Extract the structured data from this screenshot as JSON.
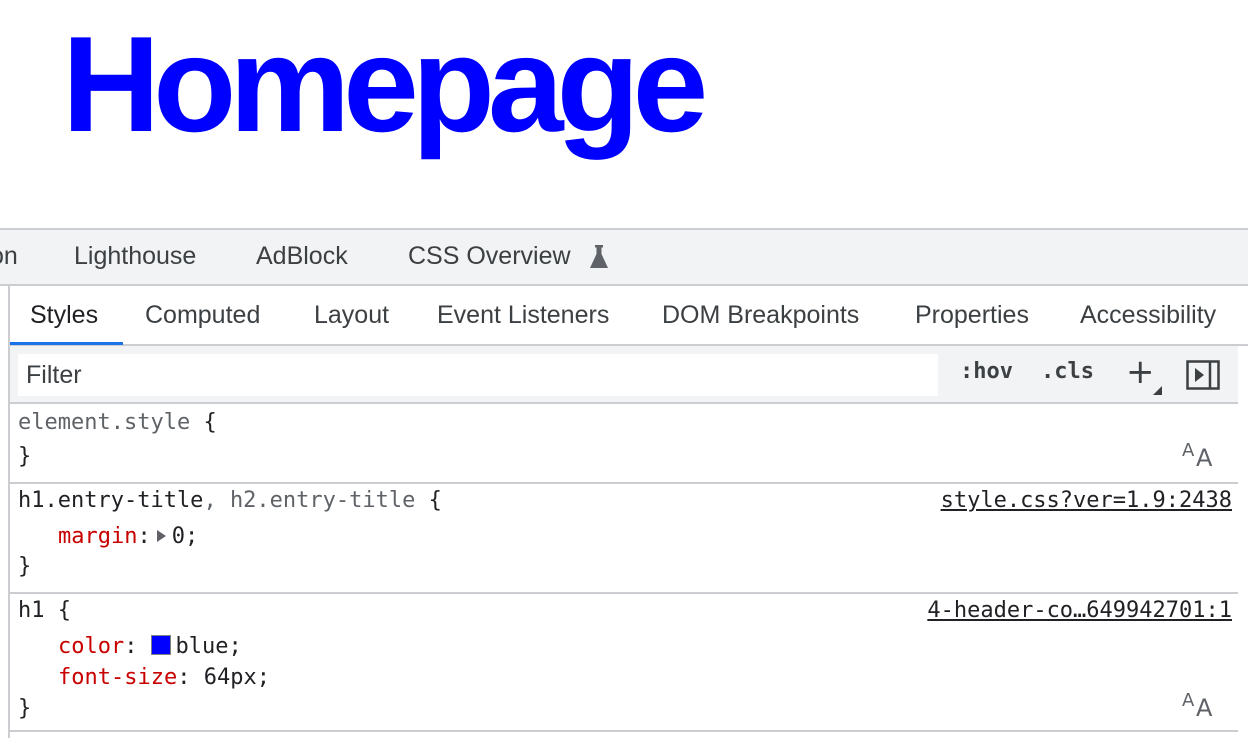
{
  "page": {
    "heading": "Homepage",
    "heading_color": "#0000ff"
  },
  "devtools": {
    "panel_tabs": [
      {
        "label": "on"
      },
      {
        "label": "Lighthouse"
      },
      {
        "label": "AdBlock"
      },
      {
        "label": "CSS Overview",
        "icon": "flask-icon"
      }
    ],
    "sub_tabs": [
      {
        "label": "Styles",
        "active": true
      },
      {
        "label": "Computed"
      },
      {
        "label": "Layout"
      },
      {
        "label": "Event Listeners"
      },
      {
        "label": "DOM Breakpoints"
      },
      {
        "label": "Properties"
      },
      {
        "label": "Accessibility"
      }
    ],
    "filter": {
      "placeholder": "Filter",
      "hov_label": ":hov",
      "cls_label": ".cls",
      "add_rule_label": "+"
    },
    "rules": {
      "element_style": {
        "selector": "element.style",
        "open": "{",
        "close": "}"
      },
      "entry_title": {
        "selector_main": "h1.entry-title",
        "selector_sep": ", ",
        "selector_dim": "h2.entry-title",
        "open": " {",
        "source": "style.css?ver=1.9:2438",
        "decl_name": "margin",
        "decl_colon": ":",
        "decl_value": "0;",
        "close": "}"
      },
      "h1": {
        "selector": "h1 {",
        "source": "4-header-co…649942701:1",
        "color_name": "color",
        "color_colon": ":",
        "color_value": "blue;",
        "color_swatch": "#0000ff",
        "size_name": "font-size",
        "size_colon": ": ",
        "size_value": "64px;",
        "close": "}"
      }
    },
    "accent_color": "#1a73e8",
    "property_color": "#c80000"
  }
}
